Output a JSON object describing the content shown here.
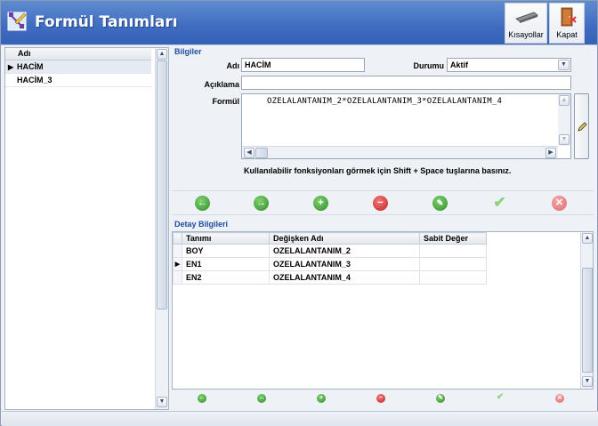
{
  "window": {
    "title": "Formül Tanımları"
  },
  "toolbar": {
    "shortcuts_label": "Kısayollar",
    "close_label": "Kapat"
  },
  "list": {
    "header": "Adı",
    "items": [
      "HACİM",
      "HACİM_3"
    ]
  },
  "details": {
    "section": "Bilgiler",
    "name_label": "Adı",
    "name_value": "HACİM",
    "status_label": "Durumu",
    "status_value": "Aktif",
    "desc_label": "Açıklama",
    "desc_value": "",
    "formula_label": "Formül",
    "formula_value": "OZELALANTANIM_2*OZELALANTANIM_3*OZELALANTANIM_4",
    "hint": "Kullanılabilir fonksiyonları görmek için Shift + Space tuşlarına basınız."
  },
  "grid": {
    "section": "Detay Bilgileri",
    "columns": [
      "Tanımı",
      "Değişken Adı",
      "Sabit Değer"
    ],
    "rows": [
      [
        "BOY",
        "OZELALANTANIM_2",
        ""
      ],
      [
        "EN1",
        "OZELALANTANIM_3",
        ""
      ],
      [
        "EN2",
        "OZELALANTANIM_4",
        ""
      ]
    ]
  },
  "colors": {
    "accent": "#3f6cc0",
    "section": "#1d4ea2",
    "green": "#3fa53a",
    "red": "#d8383a"
  },
  "icons": [
    "back-icon",
    "forward-icon",
    "add-icon",
    "delete-icon",
    "edit-icon",
    "confirm-icon",
    "cancel-icon"
  ]
}
